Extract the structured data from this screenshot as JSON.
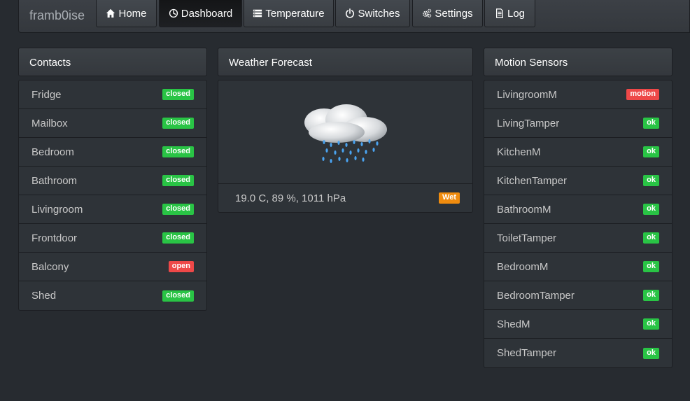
{
  "nav": {
    "brand": "framb0ise",
    "items": [
      {
        "label": "Home",
        "icon": "home-icon"
      },
      {
        "label": "Dashboard",
        "icon": "dashboard-icon"
      },
      {
        "label": "Temperature",
        "icon": "list-icon"
      },
      {
        "label": "Switches",
        "icon": "power-icon"
      },
      {
        "label": "Settings",
        "icon": "cogs-icon"
      },
      {
        "label": "Log",
        "icon": "file-icon"
      }
    ]
  },
  "contacts": {
    "title": "Contacts",
    "items": [
      {
        "label": "Fridge",
        "status": "closed"
      },
      {
        "label": "Mailbox",
        "status": "closed"
      },
      {
        "label": "Bedroom",
        "status": "closed"
      },
      {
        "label": "Bathroom",
        "status": "closed"
      },
      {
        "label": "Livingroom",
        "status": "closed"
      },
      {
        "label": "Frontdoor",
        "status": "closed"
      },
      {
        "label": "Balcony",
        "status": "open"
      },
      {
        "label": "Shed",
        "status": "closed"
      }
    ]
  },
  "weather": {
    "title": "Weather Forecast",
    "icon": "rain-cloud-icon",
    "summary": "19.0 C, 89 %, 1011 hPa",
    "badge": "Wet"
  },
  "motion": {
    "title": "Motion Sensors",
    "items": [
      {
        "label": "LivingroomM",
        "status": "motion"
      },
      {
        "label": "LivingTamper",
        "status": "ok"
      },
      {
        "label": "KitchenM",
        "status": "ok"
      },
      {
        "label": "KitchenTamper",
        "status": "ok"
      },
      {
        "label": "BathroomM",
        "status": "ok"
      },
      {
        "label": "ToiletTamper",
        "status": "ok"
      },
      {
        "label": "BedroomM",
        "status": "ok"
      },
      {
        "label": "BedroomTamper",
        "status": "ok"
      },
      {
        "label": "ShedM",
        "status": "ok"
      },
      {
        "label": "ShedTamper",
        "status": "ok"
      }
    ]
  },
  "colors": {
    "ok": "#29c445",
    "alert": "#ee4848",
    "warn": "#f08c0e",
    "background": "#272b30"
  }
}
